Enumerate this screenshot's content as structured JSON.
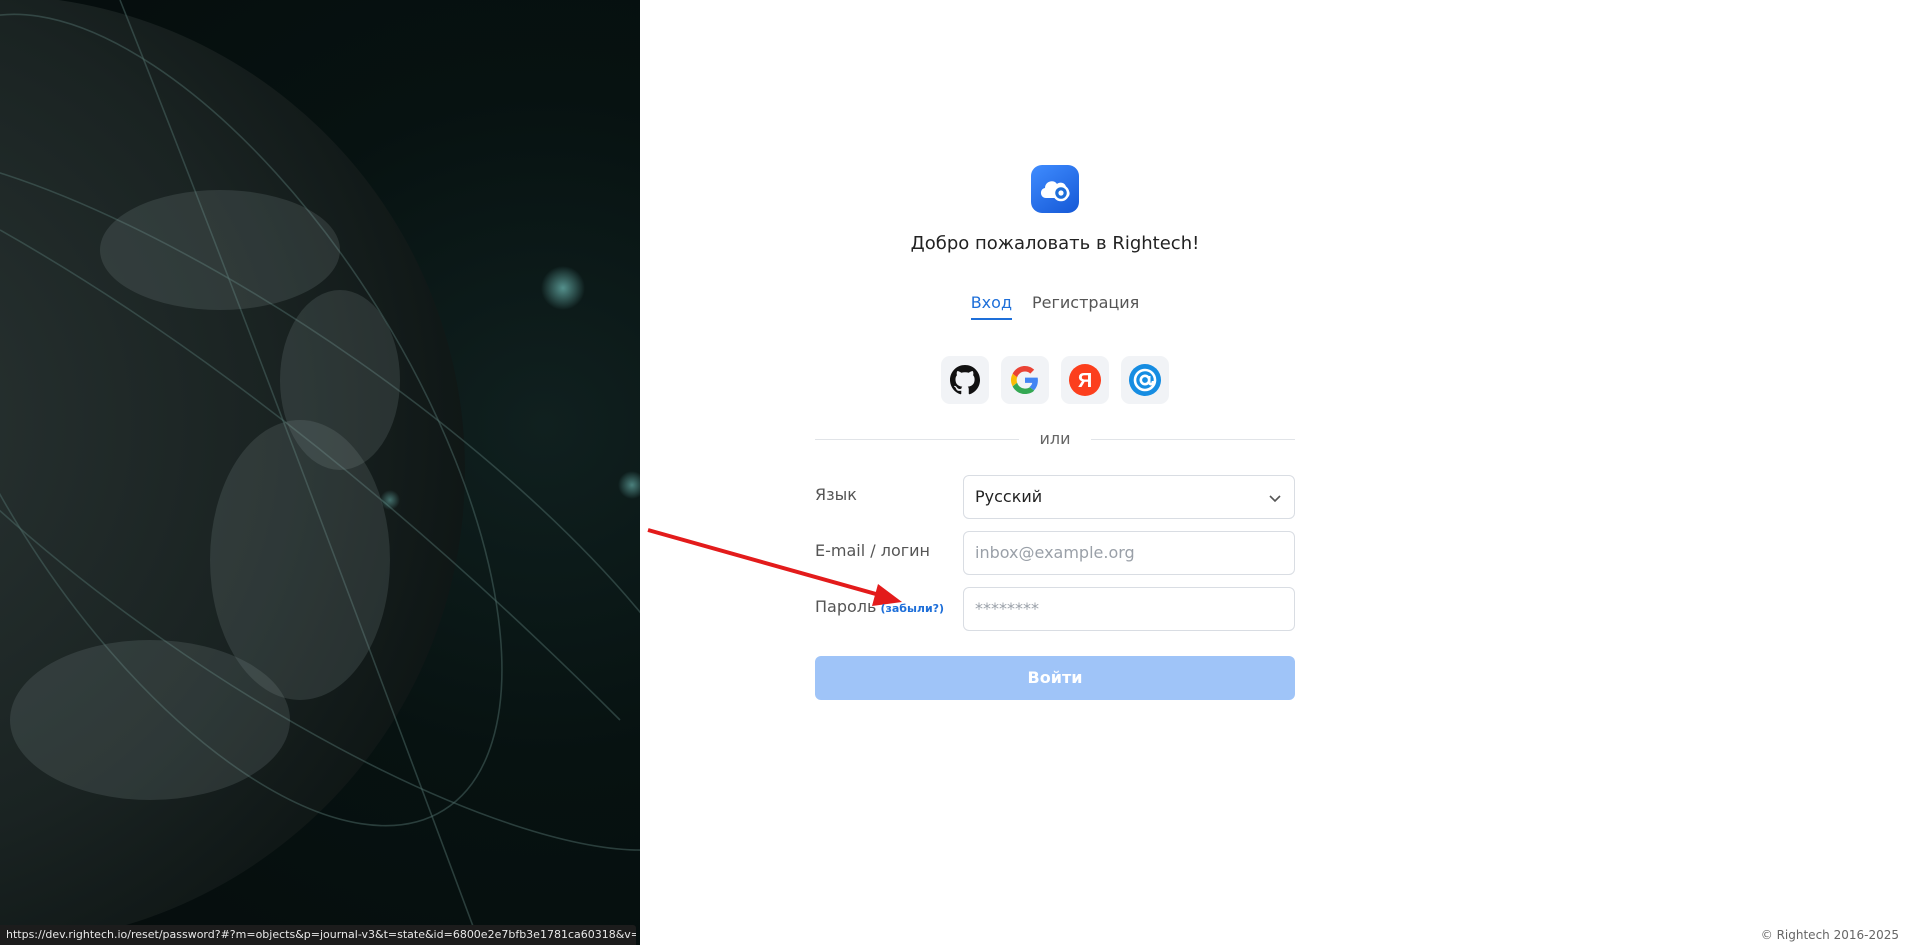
{
  "status_url": "https://dev.rightech.io/reset/password?#?m=objects&p=journal-v3&t=state&id=6800e2e7bfb3e1781ca60318&v=m...",
  "welcome": "Добро пожаловать в Rightech!",
  "tabs": [
    {
      "label": "Вход",
      "active": true
    },
    {
      "label": "Регистрация",
      "active": false
    }
  ],
  "socials": [
    "github-icon",
    "google-icon",
    "yandex-icon",
    "mailru-icon"
  ],
  "yandex_letter": "Я",
  "divider": "или",
  "form": {
    "language": {
      "label": "Язык",
      "value": "Русский"
    },
    "email": {
      "label": "E-mail / логин",
      "placeholder": "inbox@example.org"
    },
    "password": {
      "label": "Пароль",
      "forgot": "(забыли?)",
      "placeholder": "********"
    }
  },
  "submit_label": "Войти",
  "footer": "© Rightech 2016-2025",
  "colors": {
    "accent": "#1e6fd9",
    "submit_disabled": "#9fc4f8",
    "arrow": "#e31b1b"
  }
}
